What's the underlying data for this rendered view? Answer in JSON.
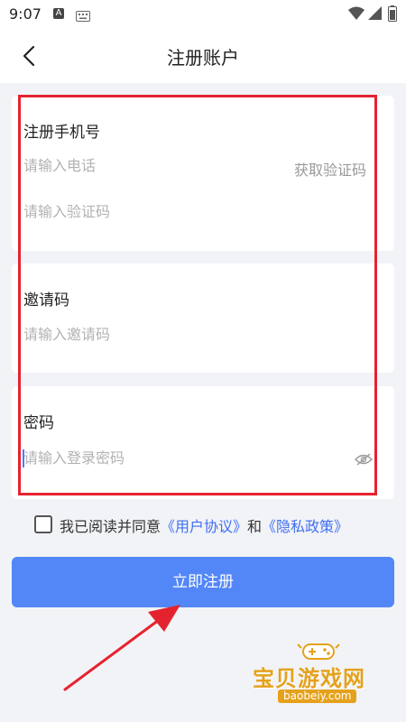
{
  "status_bar": {
    "time": "9:07",
    "notification_letter": "A",
    "icons": [
      "keyboard-icon",
      "wifi-icon",
      "signal-icon",
      "battery-icon"
    ]
  },
  "header": {
    "title": "注册账户",
    "back_icon": "chevron-left-icon"
  },
  "phone_section": {
    "label": "注册手机号",
    "phone_placeholder": "请输入电话",
    "get_code_label": "获取验证码",
    "code_placeholder": "请输入验证码"
  },
  "invite_section": {
    "label": "邀请码",
    "placeholder": "请输入邀请码"
  },
  "password_section": {
    "label": "密码",
    "placeholder": "请输入登录密码",
    "toggle_icon": "eye-off-icon"
  },
  "agreement": {
    "checked": false,
    "prefix": "我已阅读并同意",
    "user_agreement_link": "《用户协议》",
    "conjunction": "和",
    "privacy_policy_link": "《隐私政策》"
  },
  "register_button": {
    "label": "立即注册"
  },
  "watermark": {
    "title": "宝贝游戏网",
    "domain": "baobeiy.com"
  },
  "colors": {
    "accent": "#5387f8",
    "link": "#3f6ff1",
    "highlight": "#e5232f",
    "background": "#f2f3f7",
    "watermark": "#e5a11c"
  }
}
